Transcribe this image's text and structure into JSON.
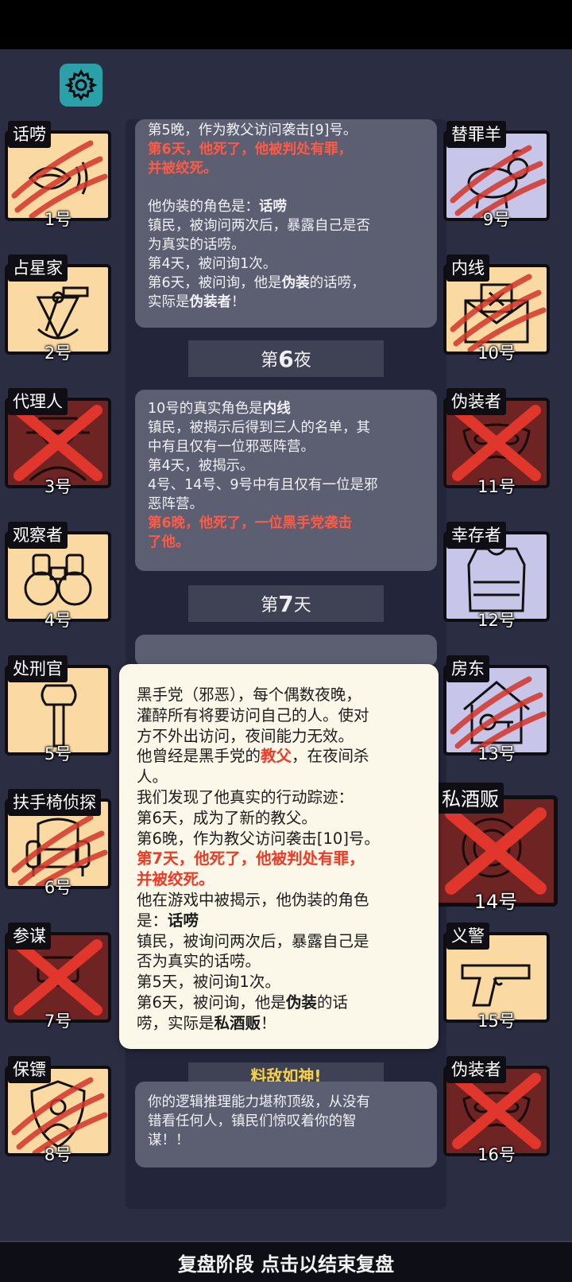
{
  "settings": {
    "icon": "gear-icon"
  },
  "log_cards": {
    "card1": {
      "l1": "第5晚，作为教父访问袭击[9]号。",
      "l2": "第6天，他死了，他被判处有罪，",
      "l3": "并被绞死。",
      "l4a": "他伪装的角色是：",
      "l4b": "话唠",
      "l5": "镇民，被询问两次后，暴露自己是否",
      "l6": "为真实的话唠。",
      "l7": "第4天，被问询1次。",
      "l8a": "第6天，被问询，他是",
      "l8b": "伪装",
      "l8c": "的话唠，",
      "l9a": "实际是",
      "l9b": "伪装者",
      "l9c": "！"
    },
    "bar_night6": {
      "a": "第",
      "n": "6",
      "b": "夜"
    },
    "card2": {
      "l1a": "10号的真实角色是",
      "l1b": "内线",
      "l2": "镇民，被揭示后得到三人的名单，其",
      "l3": "中有且仅有一位邪恶阵营。",
      "l4": "第4天，被揭示。",
      "l5": "4号、14号、9号中有且仅有一位是邪",
      "l6": "恶阵营。",
      "l7": "第6晚，他死了，一位黑手党袭击",
      "l8": "了他。"
    },
    "bar_day7": {
      "a": "第",
      "n": "7",
      "b": "天"
    },
    "bar_partial": "料敌如神!",
    "card3": {
      "l1": "你的逻辑推理能力堪称顶级，从没有",
      "l2": "错看任何人，镇民们惊叹着你的智",
      "l3": "谋！！"
    }
  },
  "popup": {
    "l1": "黑手党（邪恶），每个偶数夜晚，",
    "l2": "灌醉所有将要访问自己的人。使对",
    "l3": "方不外出访问，夜间能力无效。",
    "l4a": "他曾经是黑手党的",
    "l4b": "教父",
    "l4c": "，在夜间杀",
    "l5": "人。",
    "l6": "我们发现了他真实的行动踪迹：",
    "l7": "第6天，成为了新的教父。",
    "l8": "第6晚，作为教父访问袭击[10]号。",
    "l9": "第7天，他死了，他被判处有罪，",
    "l10": "并被绞死。",
    "l11": "他在游戏中被揭示，他伪装的角色",
    "l12a": "是：",
    "l12b": "话唠",
    "l13": "镇民，被询问两次后，暴露自己是",
    "l14": "否为真实的话唠。",
    "l15": "第5天，被问询1次。",
    "l16a": "第6天，被问询，他是",
    "l16b": "伪装",
    "l16c": "的话",
    "l17a": "唠，实际是",
    "l17b": "私酒贩",
    "l17c": "！"
  },
  "players": {
    "p1": {
      "role": "话唠",
      "num": "1号",
      "icon": "chatterbox-mouth-icon",
      "status": "clawed"
    },
    "p2": {
      "role": "占星家",
      "num": "2号",
      "icon": "sextant-icon",
      "status": "alive"
    },
    "p3": {
      "role": "代理人",
      "num": "3号",
      "icon": "agent-hat-icon",
      "status": "crossed"
    },
    "p4": {
      "role": "观察者",
      "num": "4号",
      "icon": "binoculars-icon",
      "status": "alive"
    },
    "p5": {
      "role": "处刑官",
      "num": "5号",
      "icon": "axe-icon",
      "status": "alive"
    },
    "p6": {
      "role": "扶手椅侦探",
      "num": "6号",
      "icon": "armchair-icon",
      "status": "clawed"
    },
    "p7": {
      "role": "参谋",
      "num": "7号",
      "icon": "scroll-icon",
      "status": "crossed"
    },
    "p8": {
      "role": "保镖",
      "num": "8号",
      "icon": "shield-icon",
      "status": "clawed"
    },
    "p9": {
      "role": "替罪羊",
      "num": "9号",
      "icon": "goat-icon",
      "status": "clawed"
    },
    "p10": {
      "role": "内线",
      "num": "10号",
      "icon": "envelope-icon",
      "status": "clawed"
    },
    "p11": {
      "role": "伪装者",
      "num": "11号",
      "icon": "mask-icon",
      "status": "crossed"
    },
    "p12": {
      "role": "幸存者",
      "num": "12号",
      "icon": "vest-icon",
      "status": "alive"
    },
    "p13": {
      "role": "房东",
      "num": "13号",
      "icon": "house-key-icon",
      "status": "clawed"
    },
    "p14": {
      "role": "私酒贩",
      "num": "14号",
      "icon": "bottle-icon",
      "status": "crossed"
    },
    "p15": {
      "role": "义警",
      "num": "15号",
      "icon": "pistol-icon",
      "status": "alive"
    },
    "p16": {
      "role": "伪装者",
      "num": "16号",
      "icon": "mask-icon",
      "status": "crossed"
    }
  },
  "bottom_bar": {
    "label": "复盘阶段 点击以结束复盘"
  },
  "colors": {
    "accent_red": "#ff5a45",
    "tile_beige": "#fad9a3",
    "tile_lavender": "#c7c5e8",
    "tile_dead": "#6f2424",
    "gear_teal": "#2aa0a8"
  }
}
